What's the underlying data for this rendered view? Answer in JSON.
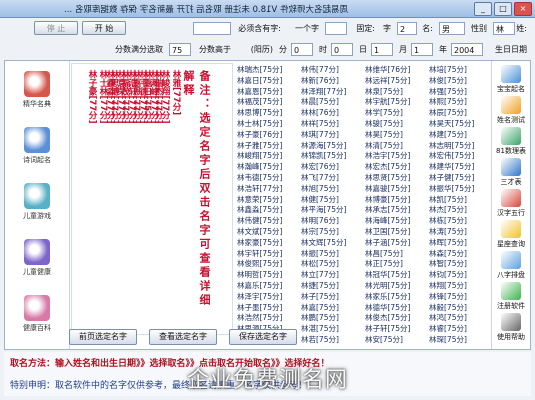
{
  "window": {
    "title": "周易起名大师软件 V18.0  未注册  取名后 打开 最新名字 保存 数据库取名 ...",
    "min": "_",
    "max": "□",
    "close": "×"
  },
  "toolbar1": {
    "label_surname": "姓:",
    "surname": "林",
    "label_gender": "性别",
    "gender": "男",
    "label_name": "名:",
    "name_len": "2",
    "label_layout": "字",
    "label_fixed": "固定:",
    "fixed_value": "",
    "label_char": "一个字",
    "label_must": "必须含有字:",
    "must_value": "",
    "start_button": "开 始",
    "stop_button": "停 止"
  },
  "toolbar2": {
    "label_birth": "生日日期",
    "year": "2004",
    "label_year": "年",
    "month": "1",
    "label_month": "月",
    "day": "1",
    "label_day": "日",
    "hour": "0",
    "label_hour": "时",
    "minute": "0",
    "label_minute": "分",
    "calendar": "(阳历)",
    "label_score": "分数高于",
    "score": "75",
    "label_range": "分数满分选取"
  },
  "left_nav": [
    {
      "label": "宝宝起名",
      "color": "#4a8fd9"
    },
    {
      "label": "姓名测试",
      "color": "#f0a020"
    },
    {
      "label": "81数理表",
      "color": "#3aa36a"
    },
    {
      "label": "三才表",
      "color": "#2f76c9"
    },
    {
      "label": "汉字五行",
      "color": "#d9463b"
    },
    {
      "label": "星座查询",
      "color": "#f2c02e"
    },
    {
      "label": "八字排盘",
      "color": "#5aa0e0"
    },
    {
      "label": "注册软件",
      "color": "#3bb34a"
    },
    {
      "label": "使用帮助",
      "color": "#666666"
    }
  ],
  "side_panel": [
    {
      "label": "精华名典",
      "color": "#d6574b"
    },
    {
      "label": "诗词起名",
      "color": "#5b8fd6"
    },
    {
      "label": "儿童游戏",
      "color": "#58b0c6"
    },
    {
      "label": "儿童健康",
      "color": "#7d64c9"
    },
    {
      "label": "健康百科",
      "color": "#d77aa8"
    }
  ],
  "highlight_names": [
    "林瑞杰[77分]",
    "林嘉日[75分]",
    "林嘉恩[77分]",
    "林福茂[77分]",
    "林思博[77分]",
    "林士林[77分]",
    "林子豪[77分]",
    "林雅[77分]",
    "林峻翔[77分]",
    "林瀚峰[77分]",
    "林韦德[77分]",
    "林浩轩[77分]",
    "林意荣[77分]",
    "林鑫淼[77分]"
  ],
  "note": "备注：选定名字后双击名字可查看详细解释",
  "name_columns": [
    [
      "林瑞杰[75分]",
      "林嘉日[75分]",
      "林嘉恩[75分]",
      "林福茂[75分]",
      "林思博[75分]",
      "林士林[75分]",
      "林子豪[76分]",
      "林子雅[75分]",
      "林峻翔[75分]",
      "林瀚峰[75分]",
      "林韦德[75分]",
      "林浩轩[77分]",
      "林意荣[75分]",
      "林鑫淼[75分]",
      "林伟健[75分]",
      "林文斌[75分]",
      "林家豪[75分]",
      "林宇轩[75分]",
      "林俊熙[75分]",
      "林明哲[75分]",
      "林嘉乐[75分]",
      "林泽宇[75分]",
      "林子墨[75分]",
      "林浩然[75分]",
      "林思源[75分]",
      "林博文[75分]"
    ],
    [
      "林伟[77分]",
      "林新[76分]",
      "林泽翔[77分]",
      "林晨[75分]",
      "林林[76分]",
      "林祥[75分]",
      "林琪[77分]",
      "林源海[75分]",
      "林锦凯[75分]",
      "林宏[76分]",
      "林飞[77分]",
      "林旭[75分]",
      "林健[75分]",
      "林平海[75分]",
      "林明[76分]",
      "林宗[75分]",
      "林文辉[75分]",
      "林振[75分]",
      "林松[75分]",
      "林立[77分]",
      "林捷[75分]",
      "林子[75分]",
      "林嘉[75分]",
      "林鹏[75分]",
      "林湛[75分]",
      "林若[75分]"
    ],
    [
      "林维华[76分]",
      "林远祥[75分]",
      "林泉[75分]",
      "林宇航[75分]",
      "林学[75分]",
      "林骏[75分]",
      "林昊[75分]",
      "林清[75分]",
      "林浩宇[75分]",
      "林宏杰[75分]",
      "林思贤[75分]",
      "林嘉骏[75分]",
      "林博豪[75分]",
      "林承志[75分]",
      "林海峰[75分]",
      "林卫国[75分]",
      "林子涵[75分]",
      "林昌[75分]",
      "林正[75分]",
      "林冠华[75分]",
      "林光明[75分]",
      "林家乐[75分]",
      "林德华[75分]",
      "林俊杰[75分]",
      "林子轩[75分]",
      "林安[75分]"
    ],
    [
      "林培[75分]",
      "林俊[75分]",
      "林强[75分]",
      "林熙[75分]",
      "林辰[75分]",
      "林昊天[75分]",
      "林建[75分]",
      "林志明[75分]",
      "林宏伟[75分]",
      "林建华[75分]",
      "林子健[75分]",
      "林振华[75分]",
      "林凯[75分]",
      "林杰[75分]",
      "林栋[75分]",
      "林涛[75分]",
      "林晖[75分]",
      "林森[75分]",
      "林智[75分]",
      "林钧[75分]",
      "林翔[75分]",
      "林锋[75分]",
      "林毅[75分]",
      "林鸿[75分]",
      "林睿[75分]",
      "林琛[75分]"
    ]
  ],
  "bottom_buttons": {
    "prev": "前页选定名字",
    "detail": "查看选定名字",
    "save": "保存选定名字"
  },
  "status": {
    "line1": "取名方法：输入姓名和出生日期》》选择取名》》点击取名开始取名》》选择好名！",
    "line2": "特别申明：取名软件中的名字仅供参考，最终取名请慎重。名字仅供参考！"
  },
  "watermark": "企业免费测名网"
}
